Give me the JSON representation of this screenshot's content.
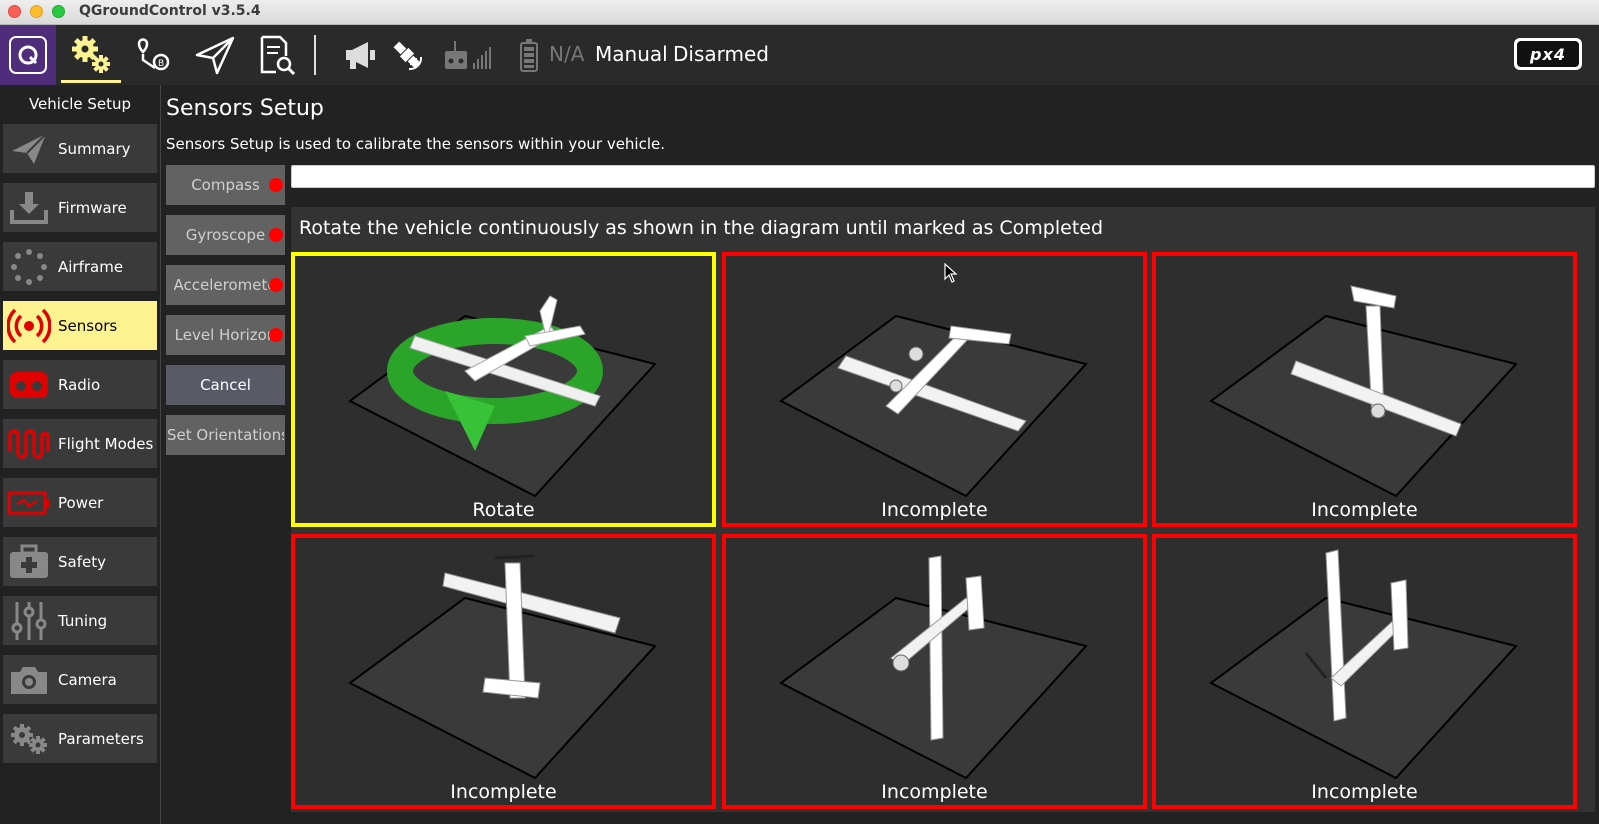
{
  "window": {
    "title": "QGroundControl v3.5.4"
  },
  "toolbar": {
    "battery_text": "N/A",
    "flight_mode": "Manual",
    "arm_state": "Disarmed",
    "autopilot_logo": "px4"
  },
  "sidebar": {
    "title": "Vehicle Setup",
    "items": [
      {
        "label": "Summary",
        "icon": "paper-plane-icon",
        "active": false
      },
      {
        "label": "Firmware",
        "icon": "download-icon",
        "active": false
      },
      {
        "label": "Airframe",
        "icon": "airframe-dots-icon",
        "active": false
      },
      {
        "label": "Sensors",
        "icon": "sensors-icon",
        "active": true
      },
      {
        "label": "Radio",
        "icon": "radio-icon",
        "active": false
      },
      {
        "label": "Flight Modes",
        "icon": "wave-icon",
        "active": false
      },
      {
        "label": "Power",
        "icon": "battery-icon",
        "active": false
      },
      {
        "label": "Safety",
        "icon": "medkit-icon",
        "active": false
      },
      {
        "label": "Tuning",
        "icon": "sliders-icon",
        "active": false
      },
      {
        "label": "Camera",
        "icon": "camera-icon",
        "active": false
      },
      {
        "label": "Parameters",
        "icon": "gears-icon",
        "active": false
      }
    ]
  },
  "main": {
    "title": "Sensors Setup",
    "description": "Sensors Setup is used to calibrate the sensors within your vehicle.",
    "sensor_buttons": [
      {
        "label": "Compass",
        "status_color": "#ff0000"
      },
      {
        "label": "Gyroscope",
        "status_color": "#ff0000"
      },
      {
        "label": "Accelerometer",
        "status_color": "#ff0000"
      },
      {
        "label": "Level Horizon",
        "status_color": "#ff0000"
      }
    ],
    "cancel_label": "Cancel",
    "set_orientations_label": "Set Orientations",
    "instruction": "Rotate the vehicle continuously as shown in the diagram until marked as Completed",
    "orientations": [
      {
        "label": "Rotate",
        "state": "current"
      },
      {
        "label": "Incomplete",
        "state": "incomplete"
      },
      {
        "label": "Incomplete",
        "state": "incomplete"
      },
      {
        "label": "Incomplete",
        "state": "incomplete"
      },
      {
        "label": "Incomplete",
        "state": "incomplete"
      },
      {
        "label": "Incomplete",
        "state": "incomplete"
      }
    ]
  },
  "colors": {
    "accent": "#fff291",
    "current_border": "#ffff00",
    "incomplete_border": "#ff0000",
    "brand_purple": "#4f2d7a"
  }
}
